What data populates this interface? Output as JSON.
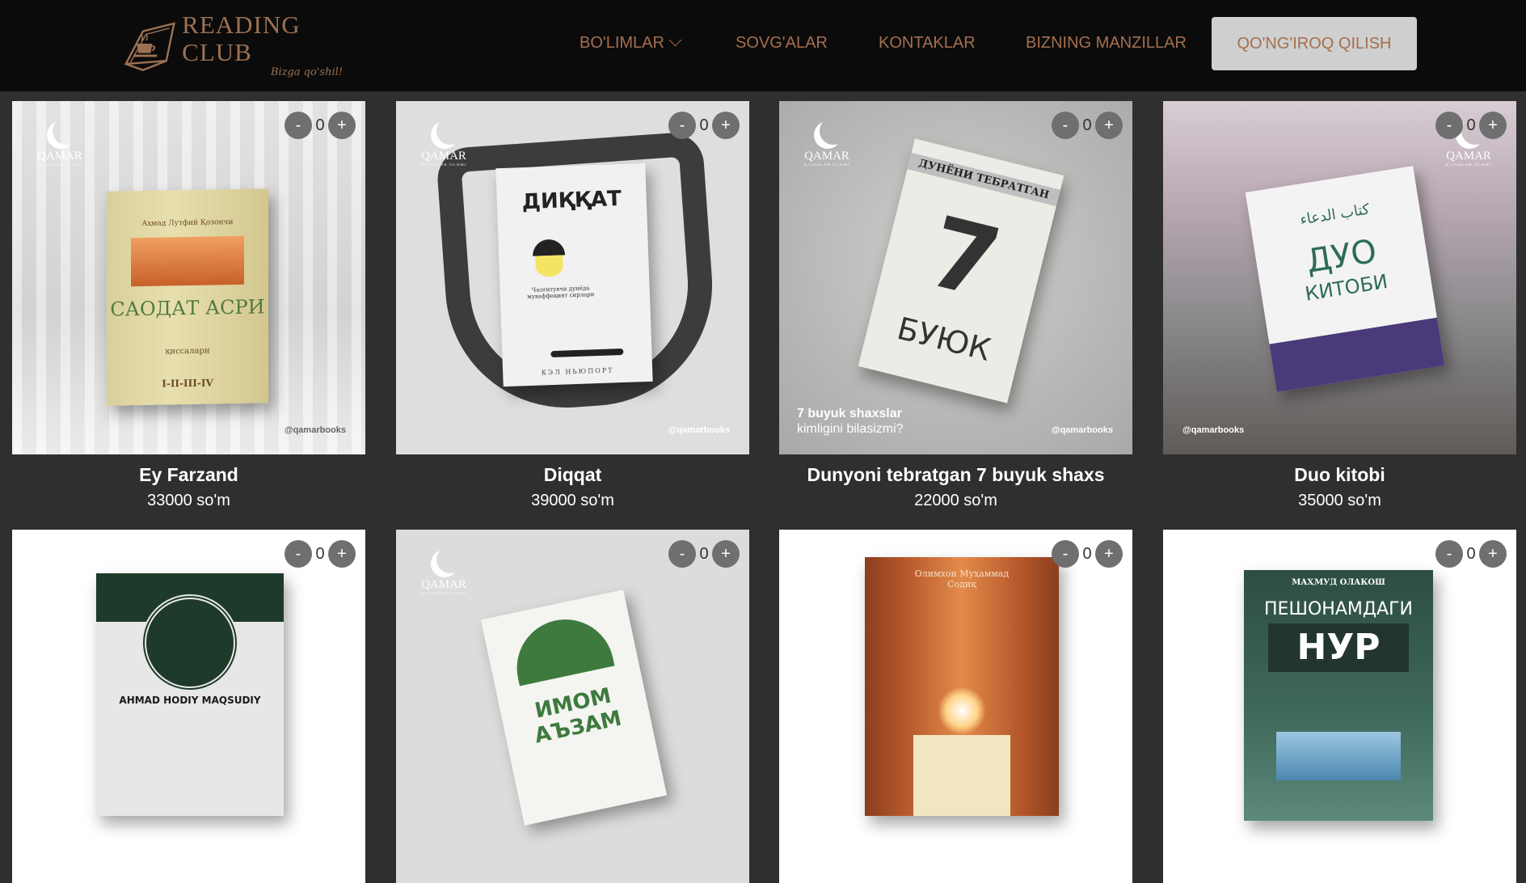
{
  "brand": {
    "title": "READING CLUB",
    "tagline": "Bizga qo'shil!"
  },
  "nav": {
    "items": [
      {
        "label": "BO'LIMLAR",
        "has_dropdown": true
      },
      {
        "label": "SOVG'ALAR"
      },
      {
        "label": "KONTAKLAR"
      },
      {
        "label": "BIZNING MANZILLAR"
      }
    ],
    "call_button": "QO'NG'IROQ QILISH"
  },
  "colors": {
    "accent": "#a56f4f",
    "background": "#2f2f2f",
    "header": "#0b0b0b"
  },
  "products": [
    {
      "title": "Ey Farzand",
      "price": "33000 so'm",
      "qty": "0",
      "cover": {
        "brand": "QAMAR",
        "brand_sub": "KITOBLAR OLAMI",
        "author": "Аҳмад Лутфий Қозончи",
        "book_title": "САОДАТ АСРИ",
        "book_sub": "қиссалари",
        "volumes": "I-II-III-IV",
        "handle": "@qamarbooks"
      }
    },
    {
      "title": "Diqqat",
      "price": "39000 so'm",
      "qty": "0",
      "cover": {
        "brand": "QAMAR",
        "brand_sub": "KITOBLAR OLAMI",
        "book_title": "ДИҚҚАТ",
        "book_sub": "Чалғитувчи дунёда муваффақият сирлари",
        "author": "КЭЛ НЬЮПОРТ",
        "handle": "@qamarbooks"
      }
    },
    {
      "title": "Dunyoni tebratgan 7 buyuk shaxs",
      "price": "22000 so'm",
      "qty": "0",
      "cover": {
        "brand": "QAMAR",
        "brand_sub": "KITOBLAR OLAMI",
        "book_title": "ДУНЁНИ ТЕБРАТГАН",
        "book_number": "7",
        "book_sub": "БУЮК",
        "caption_line1": "7 buyuk shaxslar",
        "caption_line2": "kimligini bilasizmi?",
        "handle": "@qamarbooks"
      }
    },
    {
      "title": "Duo kitobi",
      "price": "35000 so'm",
      "qty": "0",
      "cover": {
        "brand": "QAMAR",
        "brand_sub": "KITOBLAR OLAMI",
        "book_arabic": "كتاب الدعاء",
        "book_title": "ДУО",
        "book_sub": "КИТОБИ",
        "handle": "@qamarbooks"
      }
    },
    {
      "title": "",
      "price": "",
      "qty": "0",
      "cover": {
        "book_title": "AHMAD HODIY MAQSUDIY"
      }
    },
    {
      "title": "",
      "price": "",
      "qty": "0",
      "cover": {
        "brand": "QAMAR",
        "brand_sub": "KITOBLAR OLAMI",
        "book_title": "ИМОМ АЪЗАМ",
        "book_spine": "ИМОМ АЪЗАМ"
      }
    },
    {
      "title": "",
      "price": "",
      "qty": "0",
      "cover": {
        "author": "Олимхон Муҳаммад Содиқ",
        "book_spine": "Олимхон Муҳаммад Содиқ"
      }
    },
    {
      "title": "",
      "price": "",
      "qty": "0",
      "cover": {
        "author": "МАҲМУД ОЛАКОШ",
        "book_title": "ПЕШОНАМДАГИ",
        "book_sub": "НУР"
      }
    }
  ]
}
